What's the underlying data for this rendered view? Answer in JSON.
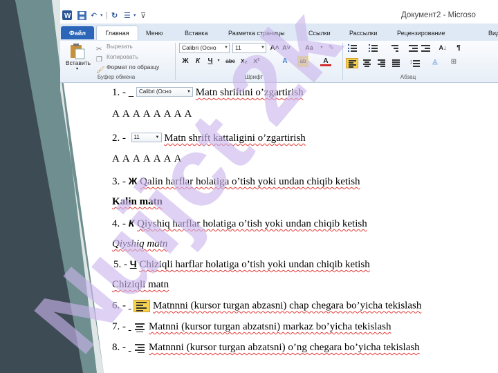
{
  "window": {
    "title": "Документ2 - Microso"
  },
  "tabs": [
    "Файл",
    "Главная",
    "Меню",
    "Вставка",
    "Разметка страницы",
    "Ссылки",
    "Рассылки",
    "Рецензирование",
    "Вид"
  ],
  "ribbon": {
    "clipboard": {
      "paste_label": "Вставить",
      "cut_label": "Вырезать",
      "copy_label": "Копировать",
      "format_painter_label": "Формат по образцу",
      "group_label": "Буфер обмена"
    },
    "font": {
      "font_name": "Calibri (Осно",
      "font_size": "11",
      "grow_label": "A˄",
      "shrink_label": "A˅",
      "case_label": "Aa",
      "bold_label": "Ж",
      "italic_label": "К",
      "underline_label": "Ч",
      "strike_label": "abc",
      "subscript_label": "x₂",
      "superscript_label": "x²",
      "group_label": "Шрифт"
    },
    "paragraph": {
      "group_label": "Абзац",
      "pilcrow": "¶"
    }
  },
  "document": {
    "l1_num": "1. -",
    "l1_combo": "Calibri (Осно",
    "l1_text": "Matn shriftini o’zgartirish",
    "l2_text": "A A A A A A A A",
    "l3_num": "2. -",
    "l3_combo": "11",
    "l3_text": "Matn shrift kattaligini o’zgartirish",
    "l4_text": "A A A A A A A",
    "l5_num": "3. -",
    "l5_glyph": "Ж",
    "l5_text": "Qalin harflar holatiga o’tish yoki undan chiqib ketish",
    "l6_text": "Kalin matn",
    "l7_num": "4. -",
    "l7_glyph": "К",
    "l7_text": "Qiyshiq harflar holatiga o’tish yoki undan chiqib ketish",
    "l8_text": "Qiyshiq matn",
    "l9_num": "5. -",
    "l9_glyph": "Ч",
    "l9_text": "Chiziqli harflar holatiga o’tish yoki undan chiqib ketish",
    "l10_text": "Chiziqli matn",
    "l11_num": "6. -",
    "l11_text": "Matnnni (kursor turgan abzasni) chap chegara bo’yicha tekislash",
    "l12_num": "7. -",
    "l12_text": "Matnni (kursor turgan abzatsni) markaz bo’yicha tekislash",
    "l13_num": "8. -",
    "l13_text": "Matnnni (kursor turgan abzatsni) o’ng chegara bo’yicha tekislash"
  },
  "watermark": {
    "text": "Nuijct 2k",
    "color": "#c9b4ec"
  },
  "colors": {
    "file_tab": "#2b66b8",
    "slide_dark": "#3d4b55",
    "slide_teal": "#6e8e8f",
    "squiggle": "#e53935",
    "highlight_yellow": "#f5d24b"
  }
}
